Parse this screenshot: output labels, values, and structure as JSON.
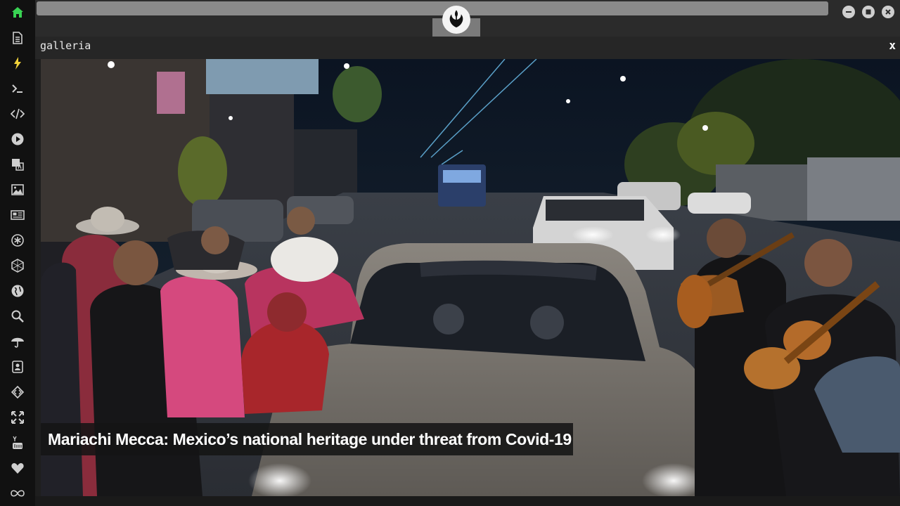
{
  "panel": {
    "title": "galleria",
    "close_label": "x"
  },
  "gallery": {
    "caption": "Mariachi Mecca: Mexico’s national heritage under threat from Covid-19"
  },
  "sidebar": {
    "items": [
      {
        "icon": "home-icon",
        "color": "#39d353"
      },
      {
        "icon": "document-icon",
        "color": "#cfcfcf"
      },
      {
        "icon": "lightning-icon",
        "color": "#f1d23a"
      },
      {
        "icon": "terminal-icon",
        "color": "#cfcfcf"
      },
      {
        "icon": "code-icon",
        "color": "#cfcfcf"
      },
      {
        "icon": "play-icon",
        "color": "#cfcfcf"
      },
      {
        "icon": "translate-icon",
        "color": "#cfcfcf"
      },
      {
        "icon": "image-icon",
        "color": "#cfcfcf"
      },
      {
        "icon": "newspaper-icon",
        "color": "#cfcfcf"
      },
      {
        "icon": "asterisk-icon",
        "color": "#cfcfcf"
      },
      {
        "icon": "hexagon-icon",
        "color": "#cfcfcf"
      },
      {
        "icon": "globe-icon",
        "color": "#cfcfcf"
      },
      {
        "icon": "search-icon",
        "color": "#cfcfcf"
      },
      {
        "icon": "umbrella-icon",
        "color": "#cfcfcf"
      },
      {
        "icon": "contact-icon",
        "color": "#cfcfcf"
      },
      {
        "icon": "diamond-code-icon",
        "color": "#cfcfcf"
      },
      {
        "icon": "expand-icon",
        "color": "#cfcfcf"
      },
      {
        "icon": "youtube-icon",
        "color": "#cfcfcf"
      },
      {
        "icon": "heart-icon",
        "color": "#cfcfcf"
      },
      {
        "icon": "infinity-icon",
        "color": "#cfcfcf"
      }
    ]
  },
  "window": {
    "controls": [
      "minimize-icon",
      "maximize-icon",
      "close-icon"
    ]
  }
}
